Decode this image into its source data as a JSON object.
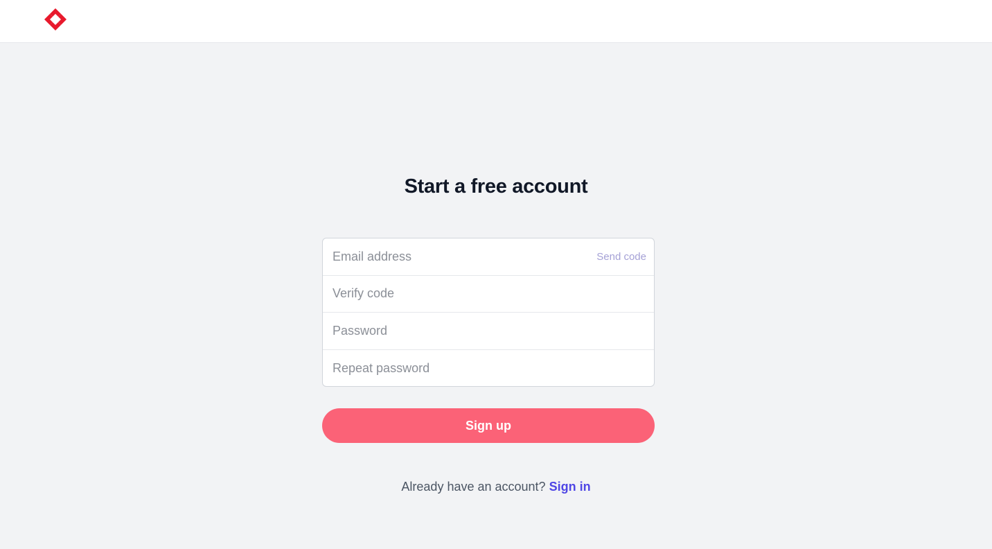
{
  "header": {
    "logo_icon": "four-diamond-logo",
    "logo_color": "#e8192c"
  },
  "main": {
    "title": "Start a free account",
    "fields": {
      "email": {
        "placeholder": "Email address",
        "value": "",
        "action_label": "Send code"
      },
      "verify_code": {
        "placeholder": "Verify code",
        "value": ""
      },
      "password": {
        "placeholder": "Password",
        "value": ""
      },
      "repeat_password": {
        "placeholder": "Repeat password",
        "value": ""
      }
    },
    "signup_label": "Sign up",
    "signin_prompt": "Already have an account?",
    "signin_link": "Sign in"
  },
  "colors": {
    "accent": "#fb6277",
    "link": "#4f46e5",
    "background": "#f2f3f5"
  }
}
